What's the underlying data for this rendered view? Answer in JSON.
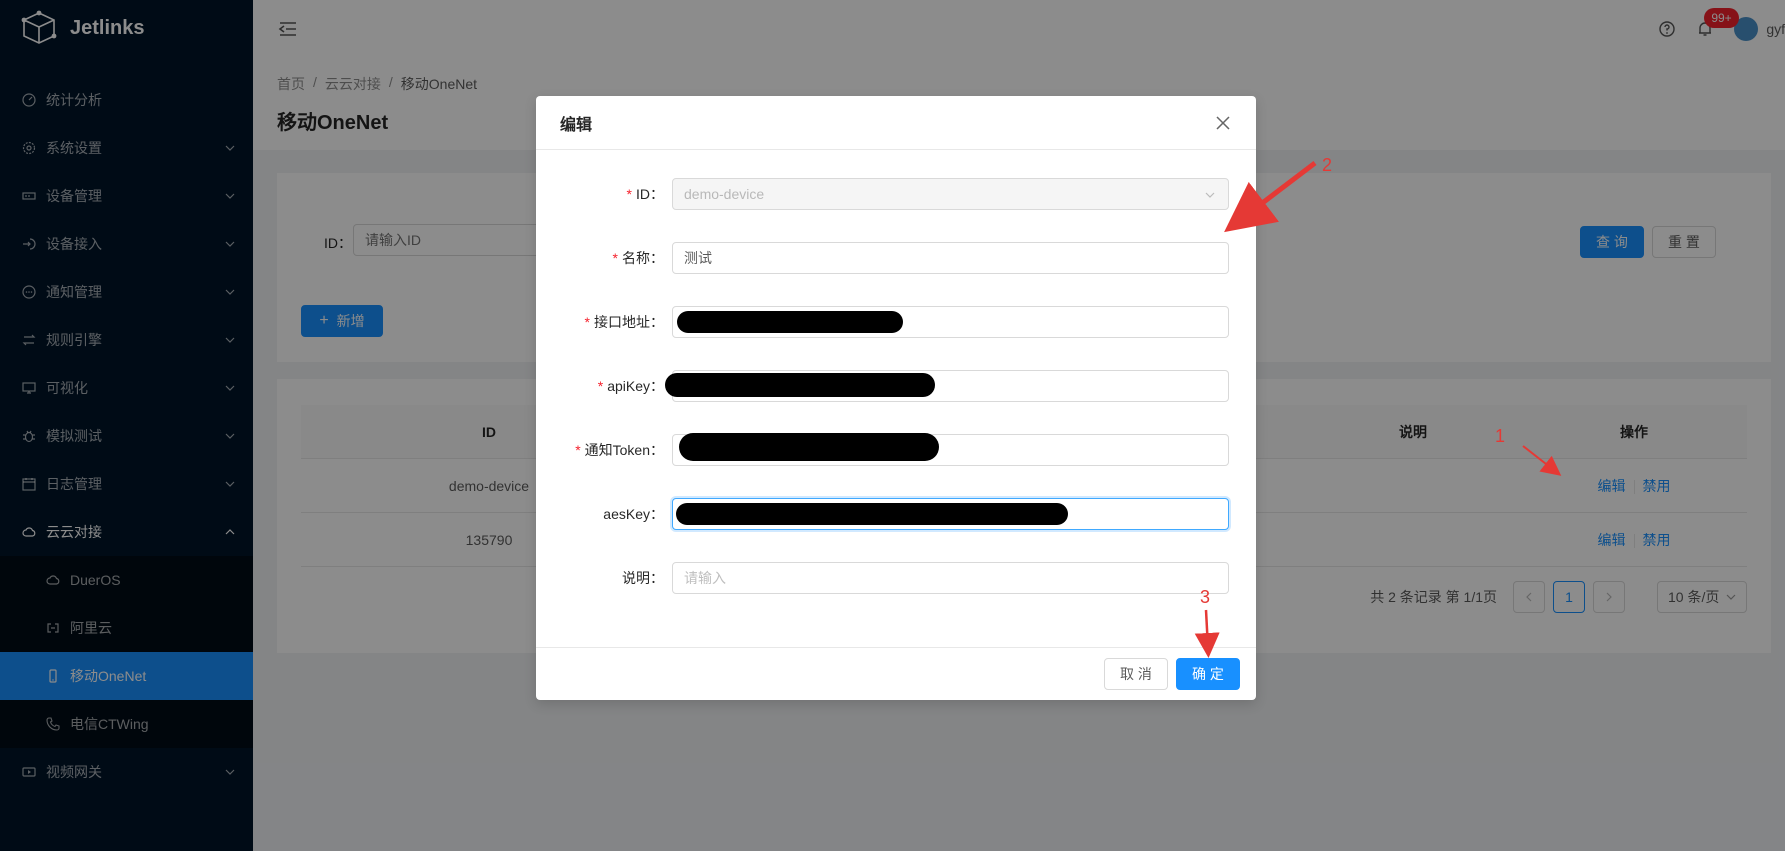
{
  "app": {
    "name": "Jetlinks"
  },
  "sidebar": {
    "items": [
      {
        "label": "统计分析",
        "icon": "dashboard-icon"
      },
      {
        "label": "系统设置",
        "icon": "gear-icon"
      },
      {
        "label": "设备管理",
        "icon": "device-icon"
      },
      {
        "label": "设备接入",
        "icon": "login-icon"
      },
      {
        "label": "通知管理",
        "icon": "message-icon"
      },
      {
        "label": "规则引擎",
        "icon": "swap-icon"
      },
      {
        "label": "可视化",
        "icon": "desktop-icon"
      },
      {
        "label": "模拟测试",
        "icon": "bug-icon"
      },
      {
        "label": "日志管理",
        "icon": "calendar-icon"
      },
      {
        "label": "云云对接",
        "icon": "cloud-icon"
      },
      {
        "label": "视频网关",
        "icon": "video-icon"
      }
    ],
    "submenu": [
      {
        "label": "DuerOS",
        "icon": "cloud-icon"
      },
      {
        "label": "阿里云",
        "icon": "link-icon"
      },
      {
        "label": "移动OneNet",
        "icon": "mobile-icon"
      },
      {
        "label": "电信CTWing",
        "icon": "phone-icon"
      }
    ]
  },
  "header": {
    "badge": "99+",
    "user": "gyf"
  },
  "breadcrumb": [
    "首页",
    "云云对接",
    "移动OneNet"
  ],
  "page_title": "移动OneNet",
  "search": {
    "label": "ID",
    "placeholder": "请输入ID",
    "query_btn": "查 询",
    "reset_btn": "重 置",
    "add_btn": "新增"
  },
  "table": {
    "columns": [
      "ID",
      "说明",
      "操作"
    ],
    "rows": [
      {
        "id": "demo-device",
        "desc": "",
        "edit": "编辑",
        "disable": "禁用"
      },
      {
        "id": "135790",
        "desc": "",
        "edit": "编辑",
        "disable": "禁用"
      }
    ],
    "pager": {
      "total": "共 2 条记录 第 1/1页",
      "page": "1",
      "size": "10 条/页"
    }
  },
  "modal": {
    "title": "编辑",
    "fields": {
      "id": {
        "label": "ID",
        "value": "demo-device"
      },
      "name": {
        "label": "名称",
        "value": "测试"
      },
      "url": {
        "label": "接口地址",
        "value": ""
      },
      "apikey": {
        "label": "apiKey",
        "value": ""
      },
      "token": {
        "label": "通知Token",
        "value": ""
      },
      "aeskey": {
        "label": "aesKey",
        "value": ""
      },
      "desc": {
        "label": "说明",
        "placeholder": "请输入"
      }
    },
    "cancel": "取 消",
    "ok": "确 定"
  },
  "annotations": {
    "n1": "1",
    "n2": "2",
    "n3": "3",
    "color": "#e53935"
  },
  "colors": {
    "primary": "#1890ff",
    "sidebar": "#001529",
    "danger": "#f5222d"
  }
}
